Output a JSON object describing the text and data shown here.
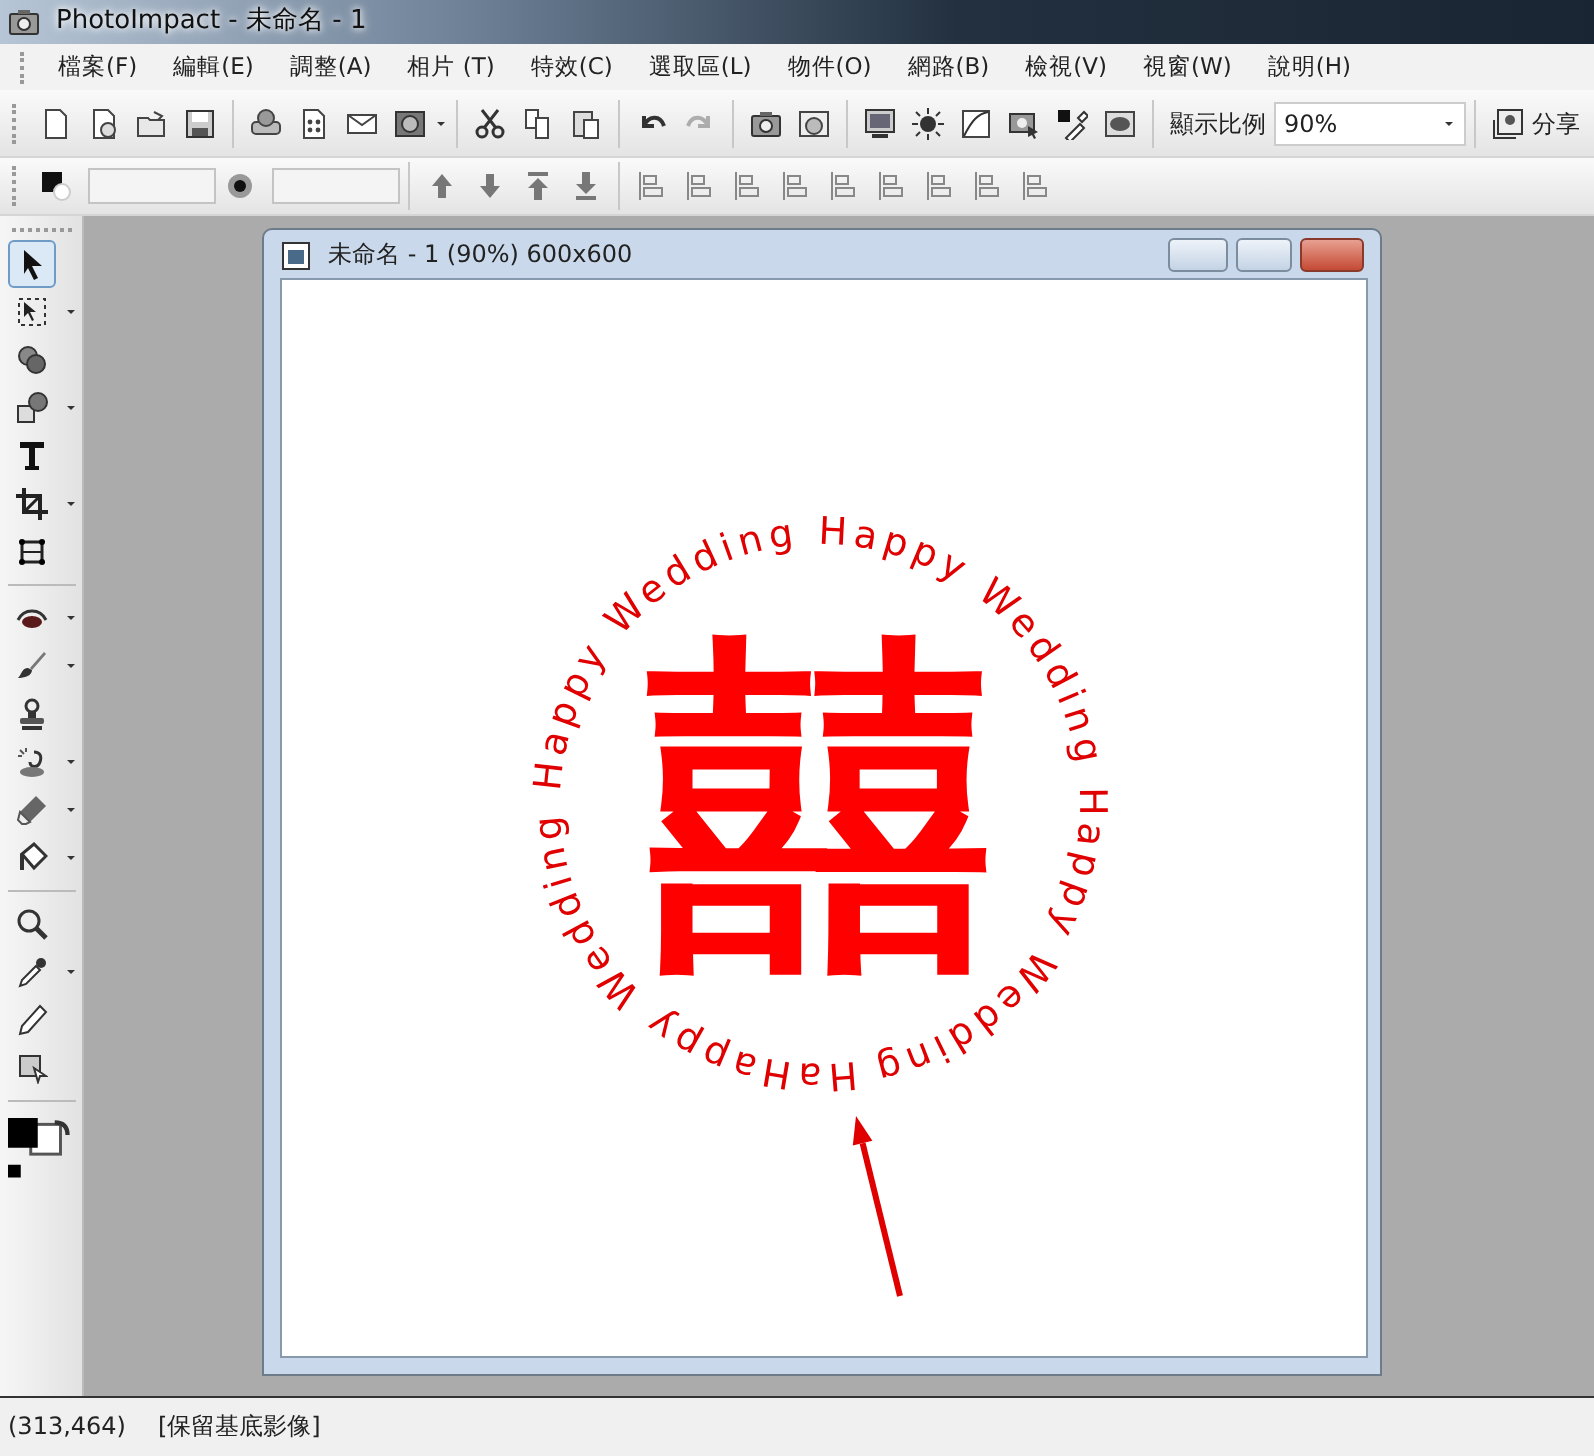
{
  "window": {
    "title": "PhotoImpact - 未命名 - 1"
  },
  "menu": [
    "檔案(F)",
    "編輯(E)",
    "調整(A)",
    "相片 (T)",
    "特效(C)",
    "選取區(L)",
    "物件(O)",
    "網路(B)",
    "檢視(V)",
    "視窗(W)",
    "說明(H)"
  ],
  "toolbar": {
    "undo_disabled": false,
    "redo_disabled": true,
    "zoom_label": "顯示比例",
    "zoom_value": "90%",
    "share": "分享"
  },
  "tools": [
    {
      "selected": true
    },
    {
      "selected": false
    },
    {
      "selected": false
    },
    {
      "selected": false
    },
    {
      "selected": false
    },
    {
      "selected": false
    },
    {
      "selected": false
    },
    {
      "selected": false
    },
    {
      "selected": false
    },
    {
      "selected": false
    },
    {
      "selected": false
    },
    {
      "selected": false
    },
    {
      "selected": false
    },
    {
      "selected": false
    },
    {
      "selected": false
    },
    {
      "selected": false
    },
    {
      "selected": false
    }
  ],
  "document": {
    "title": "未命名 - 1 (90%) 600x600",
    "circle_text": "HaHappy Wedding Happy Wedding Happy Wedding Happy Wedding",
    "center_text": "囍"
  },
  "status_bar": {
    "coordinates": "(313,464)",
    "mode": "[保留基底影像]"
  }
}
